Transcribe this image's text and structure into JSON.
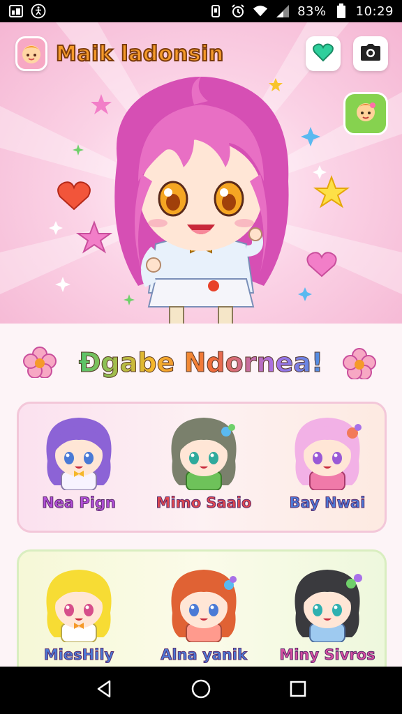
{
  "status_bar": {
    "battery": "83%",
    "time": "10:29"
  },
  "hero": {
    "app_title": "Maik ladonsin",
    "hair_color": "#e86fc4"
  },
  "section": {
    "title": "Ðgabe Ndornea!"
  },
  "characters": {
    "row1": [
      {
        "name": "Nea Pign",
        "hair": "#8c63d6",
        "shirt": "#f7f3ff",
        "name_color": "#b24fd8"
      },
      {
        "name": "Mimo Saaio",
        "hair": "#7a806c",
        "shirt": "#6ec25a",
        "name_color": "#e0484e"
      },
      {
        "name": "Bay Nwai",
        "hair": "#f2b1e6",
        "shirt": "#f07aa9",
        "name_color": "#4b79d6"
      }
    ],
    "row2": [
      {
        "name": "MiesHily",
        "hair": "#f7dc34",
        "shirt": "#ffffff",
        "name_color": "#4b79d6"
      },
      {
        "name": "Alna yanik",
        "hair": "#e06234",
        "shirt": "#ff9a8d",
        "name_color": "#4b79d6"
      },
      {
        "name": "Miny Sivros",
        "hair": "#3a3a3e",
        "shirt": "#9ecaf0",
        "name_color": "#d64ea1"
      }
    ]
  },
  "colors": {
    "accent": "#f59a2a",
    "heart": "#2fcf9c",
    "pink_bg": "#f5b6d3"
  },
  "icons": {
    "heart_button": "heart-icon",
    "camera_button": "camera-icon",
    "chat": "chat-bubble-icon",
    "nav_back": "back-triangle-icon",
    "nav_home": "home-circle-icon",
    "nav_recents": "recents-square-icon"
  }
}
